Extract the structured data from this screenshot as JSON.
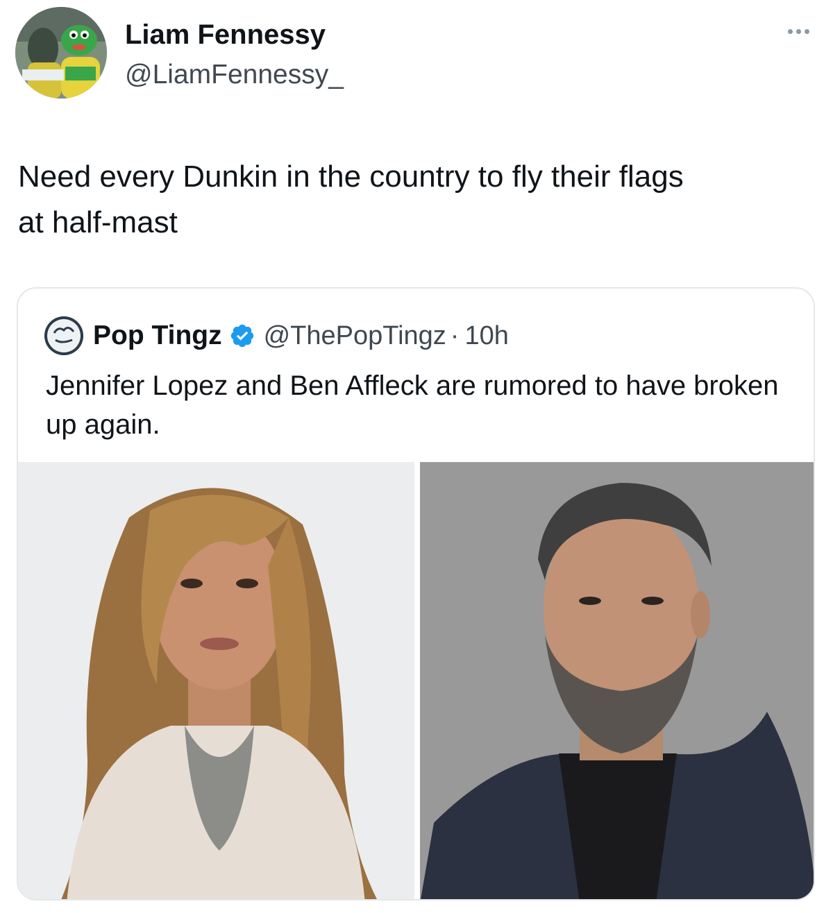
{
  "tweet": {
    "author": {
      "name": "Liam Fennessy",
      "handle": "@LiamFennessy_",
      "avatar_icon": "mascot-avatar"
    },
    "menu_icon": "more-horizontal-icon",
    "text": "Need every Dunkin in the country to fly their flags\nat half-mast"
  },
  "quote": {
    "author": {
      "name": "Pop Tingz",
      "handle": "@ThePopTingz",
      "separator": "·",
      "time": "10h",
      "avatar_icon": "pop-tingz-logo",
      "verified_icon": "verified-badge-icon"
    },
    "text": "Jennifer Lopez and Ben Affleck are rumored to have broken up again.",
    "media": [
      {
        "icon": "photo-woman-portrait"
      },
      {
        "icon": "photo-man-portrait"
      }
    ]
  },
  "colors": {
    "text": "#0f1419",
    "secondary_text": "#404850",
    "border": "#e3e7ea",
    "verified_blue": "#1d9bf0"
  }
}
